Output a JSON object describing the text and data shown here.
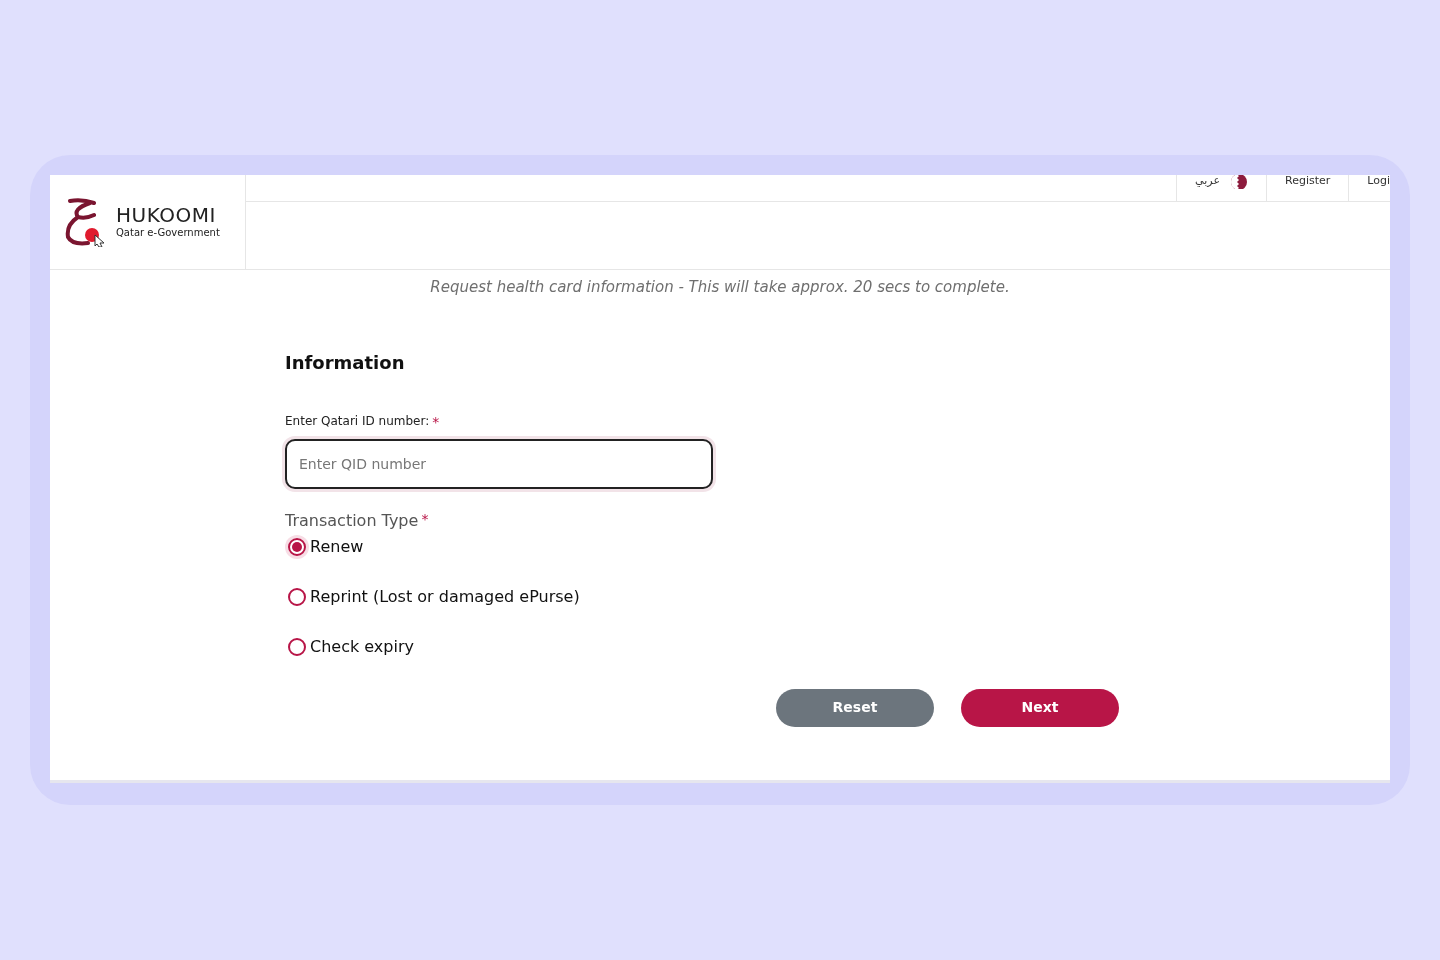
{
  "header": {
    "brand": "HUKOOMI",
    "tagline": "Qatar e-Government",
    "links": [
      {
        "kind": "language",
        "label": "عربي"
      },
      {
        "kind": "text",
        "label": "Register"
      },
      {
        "kind": "text",
        "label": "Logi"
      }
    ]
  },
  "subtitle": "Request health card information - This will take approx. 20 secs to complete.",
  "form": {
    "title": "Information",
    "qid": {
      "label": "Enter Qatari ID number:",
      "required_mark": "*",
      "placeholder": "Enter QID number"
    },
    "transaction": {
      "label": "Transaction Type",
      "required_mark": "*",
      "options": [
        {
          "label": "Renew",
          "selected": true
        },
        {
          "label": "Reprint (Lost or damaged ePurse)",
          "selected": false
        },
        {
          "label": "Check expiry",
          "selected": false
        }
      ]
    },
    "buttons": [
      {
        "kind": "secondary",
        "label": "Reset"
      },
      {
        "kind": "primary",
        "label": "Next"
      }
    ]
  }
}
